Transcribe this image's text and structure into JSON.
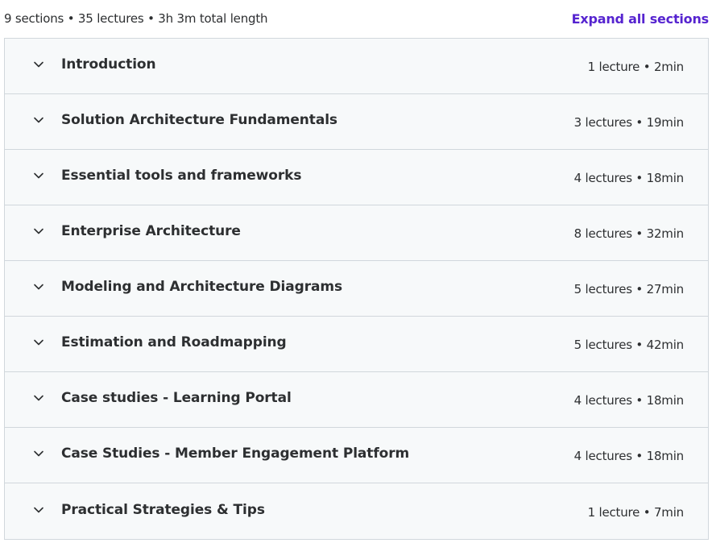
{
  "summary": {
    "text": "9 sections • 35 lectures • 3h 3m total length",
    "expand_label": "Expand all sections"
  },
  "sections": [
    {
      "title": "Introduction",
      "meta": "1 lecture • 2min"
    },
    {
      "title": "Solution Architecture Fundamentals",
      "meta": "3 lectures • 19min"
    },
    {
      "title": "Essential tools and frameworks",
      "meta": "4 lectures • 18min"
    },
    {
      "title": "Enterprise Architecture",
      "meta": "8 lectures • 32min"
    },
    {
      "title": "Modeling and Architecture Diagrams",
      "meta": "5 lectures • 27min"
    },
    {
      "title": "Estimation and Roadmapping",
      "meta": "5 lectures • 42min"
    },
    {
      "title": "Case studies - Learning Portal",
      "meta": "4 lectures • 18min"
    },
    {
      "title": "Case Studies - Member Engagement Platform",
      "meta": "4 lectures • 18min"
    },
    {
      "title": "Practical Strategies & Tips",
      "meta": "1 lecture • 7min"
    }
  ],
  "icons": {
    "section_toggle": "chevron-down-icon"
  },
  "colors": {
    "accent": "#5624d0",
    "row_bg": "#f7f9fa",
    "border": "#d1d7dc",
    "text": "#2d2f31"
  }
}
